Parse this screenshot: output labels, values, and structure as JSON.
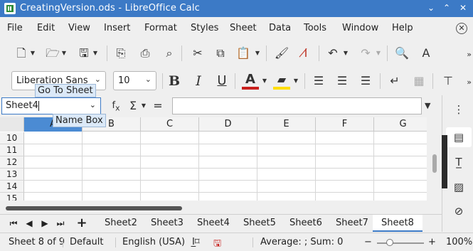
{
  "window": {
    "title": "CreatingVersion.ods - LibreOffice Calc",
    "controls": [
      "⌄",
      "⌃",
      "✕"
    ]
  },
  "menu": [
    "File",
    "Edit",
    "View",
    "Insert",
    "Format",
    "Styles",
    "Sheet",
    "Data",
    "Tools",
    "Window",
    "Help"
  ],
  "toolbar": {
    "font_name": "Liberation Sans",
    "font_size": "10"
  },
  "formula_bar": {
    "name_box_value": "Sheet4",
    "formula_value": ""
  },
  "tooltips": {
    "go_to_sheet": "Go To Sheet",
    "name_box": "Name Box"
  },
  "grid": {
    "columns": [
      "A",
      "B",
      "C",
      "D",
      "E",
      "F",
      "G"
    ],
    "rows": [
      "10",
      "11",
      "12",
      "13",
      "14",
      "15"
    ]
  },
  "sheet_tabs": [
    "Sheet2",
    "Sheet3",
    "Sheet4",
    "Sheet5",
    "Sheet6",
    "Sheet7",
    "Sheet8"
  ],
  "active_tab": "Sheet8",
  "status": {
    "sheet_info": "Sheet 8 of 9",
    "page_style": "Default",
    "language": "English (USA)",
    "summary": "Average: ; Sum: 0",
    "zoom": "100%",
    "zoom_minus": "−",
    "zoom_plus": "+"
  },
  "colors": {
    "title_bar": "#3c7ac6",
    "selection": "#4b8bd3",
    "tooltip_bg": "#dbe9f8"
  }
}
